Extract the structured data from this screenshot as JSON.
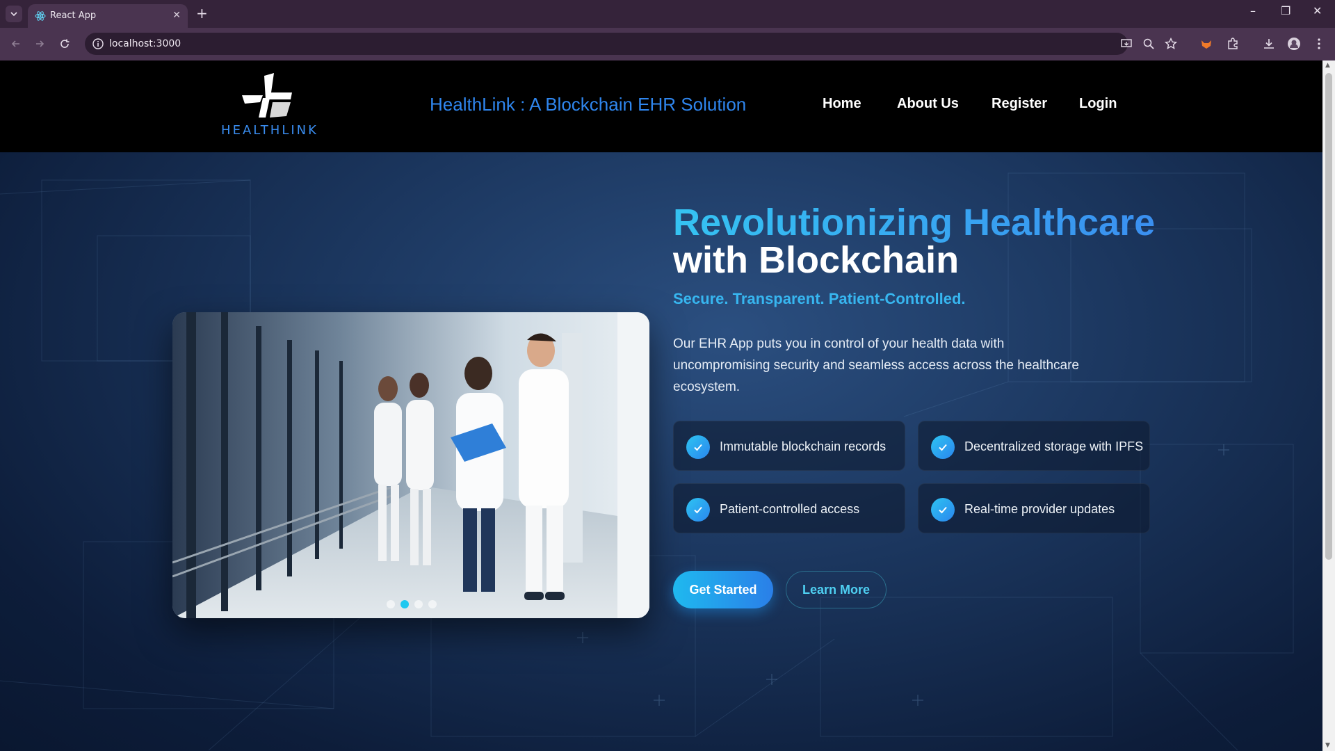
{
  "browser": {
    "tab_title": "React App",
    "tab_close": "✕",
    "new_tab": "+",
    "url": "localhost:3000",
    "window_controls": {
      "minimize": "–",
      "restore": "❐",
      "close": "✕"
    }
  },
  "header": {
    "logo_text": "HEALTHLINK",
    "site_title": "HealthLink : A Blockchain EHR Solution",
    "nav": [
      "Home",
      "About Us",
      "Register",
      "Login"
    ]
  },
  "hero": {
    "headline_line1": "Revolutionizing Healthcare",
    "headline_line2": "with Blockchain",
    "tagline": "Secure. Transparent. Patient-Controlled.",
    "description": "Our EHR App puts you in control of your health data with uncompromising security and seamless access across the healthcare ecosystem.",
    "features": [
      "Immutable blockchain records",
      "Decentralized storage with IPFS",
      "Patient-controlled access",
      "Real-time provider updates"
    ],
    "primary_button": "Get Started",
    "secondary_button": "Learn More",
    "slider": {
      "slide_count": 4,
      "active_index": 1
    }
  },
  "colors": {
    "accent_cyan": "#2ec4f2",
    "accent_blue": "#2a86ee",
    "header_bg": "#000000",
    "chrome_bg": "#35233a"
  }
}
